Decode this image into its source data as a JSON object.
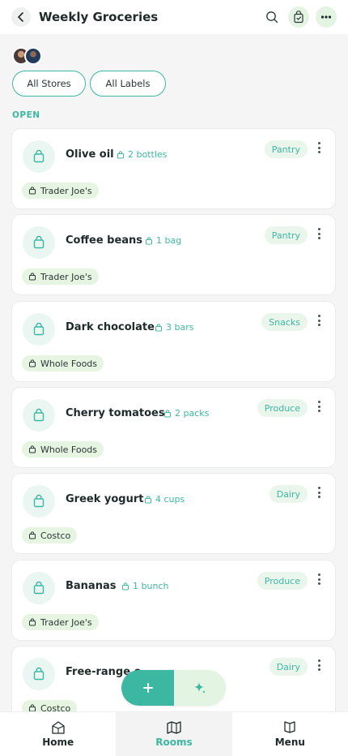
{
  "header": {
    "title": "Weekly Groceries"
  },
  "filters": [
    {
      "label": "All Stores"
    },
    {
      "label": "All Labels"
    }
  ],
  "section": {
    "label": "OPEN"
  },
  "items": [
    {
      "name": "Olive oil",
      "qty": "2 bottles",
      "category": "Pantry",
      "store": "Trader Joe's"
    },
    {
      "name": "Coffee beans",
      "qty": "1 bag",
      "category": "Pantry",
      "store": "Trader Joe's"
    },
    {
      "name": "Dark chocolate",
      "qty": "3 bars",
      "category": "Snacks",
      "store": "Whole Foods"
    },
    {
      "name": "Cherry tomatoes",
      "qty": "2 packs",
      "category": "Produce",
      "store": "Whole Foods"
    },
    {
      "name": "Greek yogurt",
      "qty": "4 cups",
      "category": "Dairy",
      "store": "Costco"
    },
    {
      "name": "Bananas",
      "qty": "1 bunch",
      "category": "Produce",
      "store": "Trader Joe's"
    },
    {
      "name": "Free-range e",
      "qty": "",
      "category": "Dairy",
      "store": "Costco"
    }
  ],
  "nav": [
    {
      "label": "Home",
      "icon": "home-icon"
    },
    {
      "label": "Rooms",
      "icon": "rooms-icon"
    },
    {
      "label": "Menu",
      "icon": "menu-book-icon"
    }
  ],
  "colors": {
    "accent": "#3cb8a2",
    "badge_bg": "#eaf6ec",
    "store_bg": "#e6f5e2"
  }
}
